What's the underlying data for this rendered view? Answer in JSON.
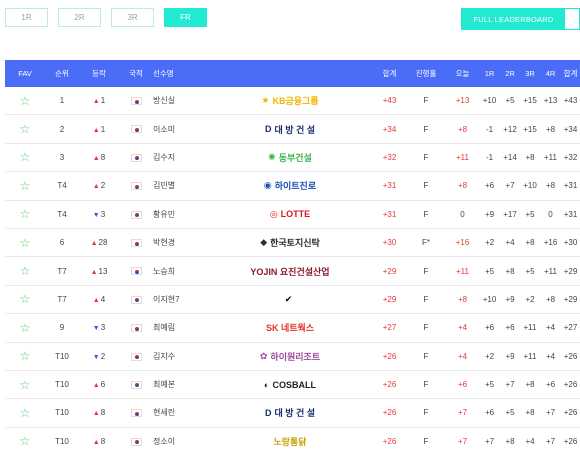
{
  "round_tabs": [
    "1R",
    "2R",
    "3R",
    "FR"
  ],
  "active_tab": "FR",
  "leaderboard_button": "FULL LEADERBOARD",
  "headers": {
    "fav": "FAV",
    "rank": "순위",
    "move": "등락",
    "nation": "국적",
    "player": "선수명",
    "total": "합계",
    "thru": "진행홀",
    "today": "오늘",
    "r1": "1R",
    "r2": "2R",
    "r3": "3R",
    "r4": "4R",
    "agg": "합계"
  },
  "colors": {
    "accent": "#22ead2",
    "header": "#4a6cf7",
    "up": "#e53935",
    "down": "#2a62d8",
    "star": "#5cc46a"
  },
  "rows": [
    {
      "fav": "☆",
      "rank": "1",
      "arrow": "▲",
      "move": "1",
      "dir": "up",
      "flag": "kr-flag",
      "name": "방신실",
      "sponsor": "KB금융그룹",
      "spon_mark": "★",
      "spon_color": "#f2b600",
      "total": "+43",
      "thru": "F",
      "today": "+13",
      "r1": "+10",
      "r2": "+5",
      "r3": "+15",
      "r4": "+13",
      "agg": "+43"
    },
    {
      "fav": "☆",
      "rank": "2",
      "arrow": "▲",
      "move": "1",
      "dir": "up",
      "flag": "kr-flag",
      "name": "이소미",
      "sponsor": "대 방 건 설",
      "spon_mark": "D",
      "spon_color": "#1a2d6e",
      "total": "+34",
      "thru": "F",
      "today": "+8",
      "r1": "-1",
      "r2": "+12",
      "r3": "+15",
      "r4": "+8",
      "agg": "+34"
    },
    {
      "fav": "☆",
      "rank": "3",
      "arrow": "▲",
      "move": "8",
      "dir": "up",
      "flag": "kr-flag",
      "name": "김수지",
      "sponsor": "동부건설",
      "spon_mark": "✺",
      "spon_color": "#3ab34a",
      "total": "+32",
      "thru": "F",
      "today": "+11",
      "r1": "-1",
      "r2": "+14",
      "r3": "+8",
      "r4": "+11",
      "agg": "+32"
    },
    {
      "fav": "☆",
      "rank": "T4",
      "arrow": "▲",
      "move": "2",
      "dir": "up",
      "flag": "kr-flag",
      "name": "김민별",
      "sponsor": "하이트진로",
      "spon_mark": "◉",
      "spon_color": "#1b4db3",
      "total": "+31",
      "thru": "F",
      "today": "+8",
      "r1": "+6",
      "r2": "+7",
      "r3": "+10",
      "r4": "+8",
      "agg": "+31"
    },
    {
      "fav": "☆",
      "rank": "T4",
      "arrow": "▼",
      "move": "3",
      "dir": "down",
      "flag": "kr-flag",
      "name": "황유민",
      "sponsor": "LOTTE",
      "spon_mark": "◎",
      "spon_color": "#d71920",
      "total": "+31",
      "thru": "F",
      "today": "0",
      "r1": "+9",
      "r2": "+17",
      "r3": "+5",
      "r4": "0",
      "agg": "+31"
    },
    {
      "fav": "☆",
      "rank": "6",
      "arrow": "▲",
      "move": "28",
      "dir": "up",
      "flag": "kr-flag",
      "name": "박현경",
      "sponsor": "한국토지신탁",
      "spon_mark": "◆",
      "spon_color": "#2c2c2c",
      "total": "+30",
      "thru": "F*",
      "today": "+16",
      "r1": "+2",
      "r2": "+4",
      "r3": "+8",
      "r4": "+16",
      "agg": "+30"
    },
    {
      "fav": "☆",
      "rank": "T7",
      "arrow": "▲",
      "move": "13",
      "dir": "up",
      "flag": "kr-flag",
      "name": "노승희",
      "sponsor": "YOJIN 요진건설산업",
      "spon_mark": "",
      "spon_color": "#8b1a2b",
      "total": "+29",
      "thru": "F",
      "today": "+11",
      "r1": "+5",
      "r2": "+8",
      "r3": "+5",
      "r4": "+11",
      "agg": "+29"
    },
    {
      "fav": "☆",
      "rank": "T7",
      "arrow": "▲",
      "move": "4",
      "dir": "up",
      "flag": "kr-flag",
      "name": "이지현7",
      "sponsor": "",
      "spon_mark": "✔",
      "spon_color": "#111111",
      "total": "+29",
      "thru": "F",
      "today": "+8",
      "r1": "+10",
      "r2": "+9",
      "r3": "+2",
      "r4": "+8",
      "agg": "+29"
    },
    {
      "fav": "☆",
      "rank": "9",
      "arrow": "▼",
      "move": "3",
      "dir": "down",
      "flag": "kr-flag",
      "name": "최예림",
      "sponsor": "SK 네트웍스",
      "spon_mark": "",
      "spon_color": "#e5322d",
      "total": "+27",
      "thru": "F",
      "today": "+4",
      "r1": "+6",
      "r2": "+6",
      "r3": "+11",
      "r4": "+4",
      "agg": "+27"
    },
    {
      "fav": "☆",
      "rank": "T10",
      "arrow": "▼",
      "move": "2",
      "dir": "down",
      "flag": "kr-flag",
      "name": "김지수",
      "sponsor": "하이원리조트",
      "spon_mark": "✿",
      "spon_color": "#9b4aa0",
      "total": "+26",
      "thru": "F",
      "today": "+4",
      "r1": "+2",
      "r2": "+9",
      "r3": "+11",
      "r4": "+4",
      "agg": "+26"
    },
    {
      "fav": "☆",
      "rank": "T10",
      "arrow": "▲",
      "move": "6",
      "dir": "up",
      "flag": "kr-flag",
      "name": "최예본",
      "sponsor": "COSBALL",
      "spon_mark": "◐",
      "spon_color": "#222222",
      "total": "+26",
      "thru": "F",
      "today": "+6",
      "r1": "+5",
      "r2": "+7",
      "r3": "+8",
      "r4": "+6",
      "agg": "+26"
    },
    {
      "fav": "☆",
      "rank": "T10",
      "arrow": "▲",
      "move": "8",
      "dir": "up",
      "flag": "kr-flag",
      "name": "현세린",
      "sponsor": "대 방 건 설",
      "spon_mark": "D",
      "spon_color": "#1a2d6e",
      "total": "+26",
      "thru": "F",
      "today": "+7",
      "r1": "+6",
      "r2": "+5",
      "r3": "+8",
      "r4": "+7",
      "agg": "+26"
    },
    {
      "fav": "☆",
      "rank": "T10",
      "arrow": "▲",
      "move": "8",
      "dir": "up",
      "flag": "kr-flag",
      "name": "정소이",
      "sponsor": "노랑통닭",
      "spon_mark": "",
      "spon_color": "#c9a200",
      "total": "+26",
      "thru": "F",
      "today": "+7",
      "r1": "+7",
      "r2": "+8",
      "r3": "+4",
      "r4": "+7",
      "agg": "+26"
    }
  ]
}
